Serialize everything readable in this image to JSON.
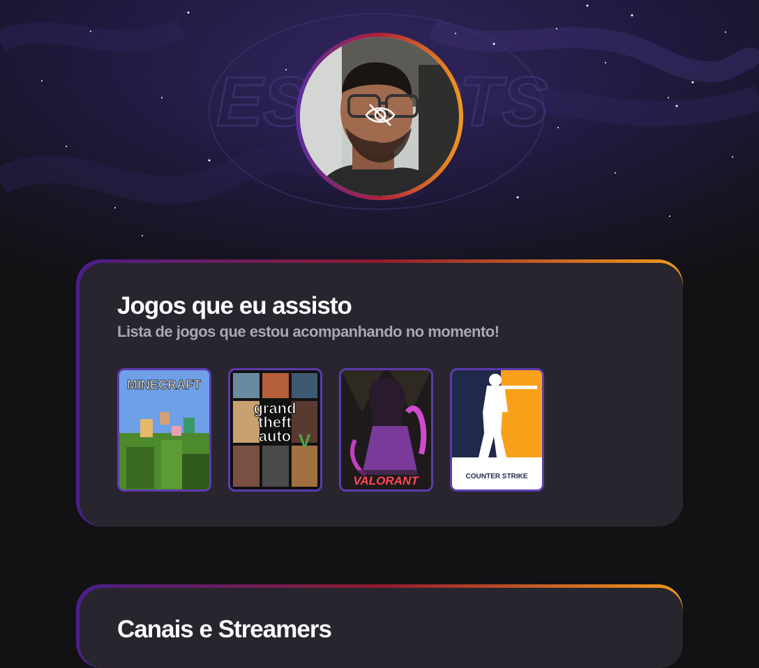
{
  "header": {
    "avatar_alt": "Foto de perfil",
    "background_logo_text": "ESPORTS"
  },
  "games_section": {
    "title": "Jogos que eu assisto",
    "subtitle": "Lista de jogos que estou acompanhando no momento!",
    "games": [
      {
        "name": "Minecraft",
        "cover_text": "MINECRAFT"
      },
      {
        "name": "Grand Theft Auto V",
        "cover_text": "grand theft auto V"
      },
      {
        "name": "Valorant",
        "cover_text": "VALORANT"
      },
      {
        "name": "Counter Strike",
        "cover_text": "COUNTER STRIKE"
      }
    ]
  },
  "channels_section": {
    "title": "Canais e Streamers"
  },
  "colors": {
    "page_bg": "#121214",
    "card_bg": "#29252f",
    "gradient_start": "#5a2fa0",
    "gradient_mid": "#b0203a",
    "gradient_end": "#f29a1e",
    "subtitle": "#a8a8b3",
    "game_border": "#5e3bb0"
  },
  "icons": [
    "hidden-eye-icon"
  ]
}
